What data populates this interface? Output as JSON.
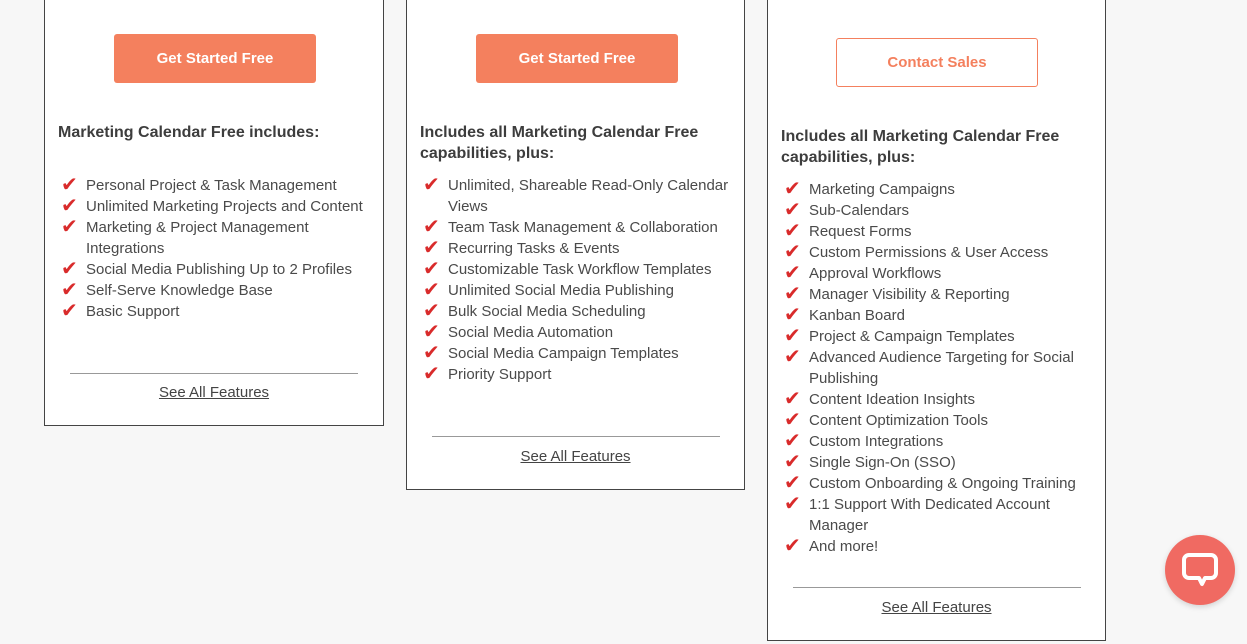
{
  "plans": [
    {
      "cta_label": "Get Started Free",
      "heading": "Marketing Calendar Free includes:",
      "features": [
        "Personal Project & Task Management",
        "Unlimited Marketing Projects and Content",
        "Marketing & Project Management Integrations",
        "Social Media Publishing Up to 2 Profiles",
        "Self-Serve Knowledge Base",
        "Basic Support"
      ],
      "see_all_label": "See All Features"
    },
    {
      "cta_label": "Get Started Free",
      "heading": "Includes all Marketing Calendar Free capabilities, plus:",
      "features": [
        "Unlimited, Shareable Read-Only Calendar Views",
        "Team Task Management & Collaboration",
        "Recurring Tasks & Events",
        "Customizable Task Workflow Templates",
        "Unlimited Social Media Publishing",
        "Bulk Social Media Scheduling",
        "Social Media Automation",
        "Social Media Campaign Templates",
        "Priority Support"
      ],
      "see_all_label": "See All Features"
    },
    {
      "cta_label": "Contact Sales",
      "heading": "Includes all Marketing Calendar Free capabilities, plus:",
      "features": [
        "Marketing Campaigns",
        "Sub-Calendars",
        "Request Forms",
        "Custom Permissions & User Access",
        "Approval Workflows",
        "Manager Visibility & Reporting",
        "Kanban Board",
        "Project & Campaign Templates",
        "Advanced Audience Targeting for Social Publishing",
        "Content Ideation Insights",
        "Content Optimization Tools",
        "Custom Integrations",
        "Single Sign-On (SSO)",
        "Custom Onboarding & Ongoing Training",
        "1:1 Support With Dedicated Account Manager",
        "And more!"
      ],
      "see_all_label": "See All Features"
    }
  ],
  "icons": {
    "feature_check": "checkmark-icon",
    "chat": "chat-bubble-icon"
  },
  "colors": {
    "accent": "#f4805e",
    "check": "#d92b2b",
    "chat_button": "#f06a62"
  }
}
